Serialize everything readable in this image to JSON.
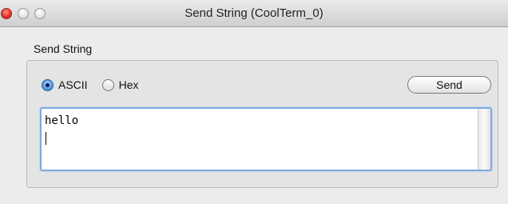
{
  "window": {
    "title": "Send String (CoolTerm_0)"
  },
  "group": {
    "label": "Send String"
  },
  "mode": {
    "options": [
      {
        "label": "ASCII",
        "selected": true
      },
      {
        "label": "Hex",
        "selected": false
      }
    ]
  },
  "actions": {
    "send_label": "Send"
  },
  "editor": {
    "text": "hello"
  },
  "colors": {
    "close": "#e5322a",
    "focus_ring": "#7fa9df",
    "radio_selected": "#5b9be6"
  }
}
